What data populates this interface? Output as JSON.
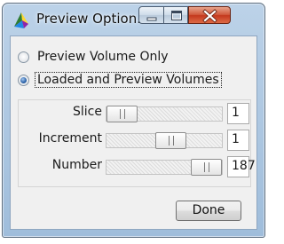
{
  "window": {
    "title": "Preview Option..."
  },
  "options": [
    {
      "label": "Preview Volume Only",
      "selected": false
    },
    {
      "label": "Loaded and Preview Volumes",
      "selected": true
    }
  ],
  "sliders": [
    {
      "label": "Slice",
      "value": "1",
      "thumb_position": 0.0
    },
    {
      "label": "Increment",
      "value": "1",
      "thumb_position": 0.58
    },
    {
      "label": "Number",
      "value": "187",
      "thumb_position": 1.0
    }
  ],
  "buttons": {
    "done_label": "Done"
  },
  "icons": {
    "app": "colorful-wand-icon",
    "minimize": "minimize-icon",
    "maximize": "maximize-icon",
    "close": "close-icon"
  },
  "colors": {
    "titlebar": "#a9c4df",
    "close_button": "#c7432a",
    "radio_selected": "#2b62a8"
  }
}
